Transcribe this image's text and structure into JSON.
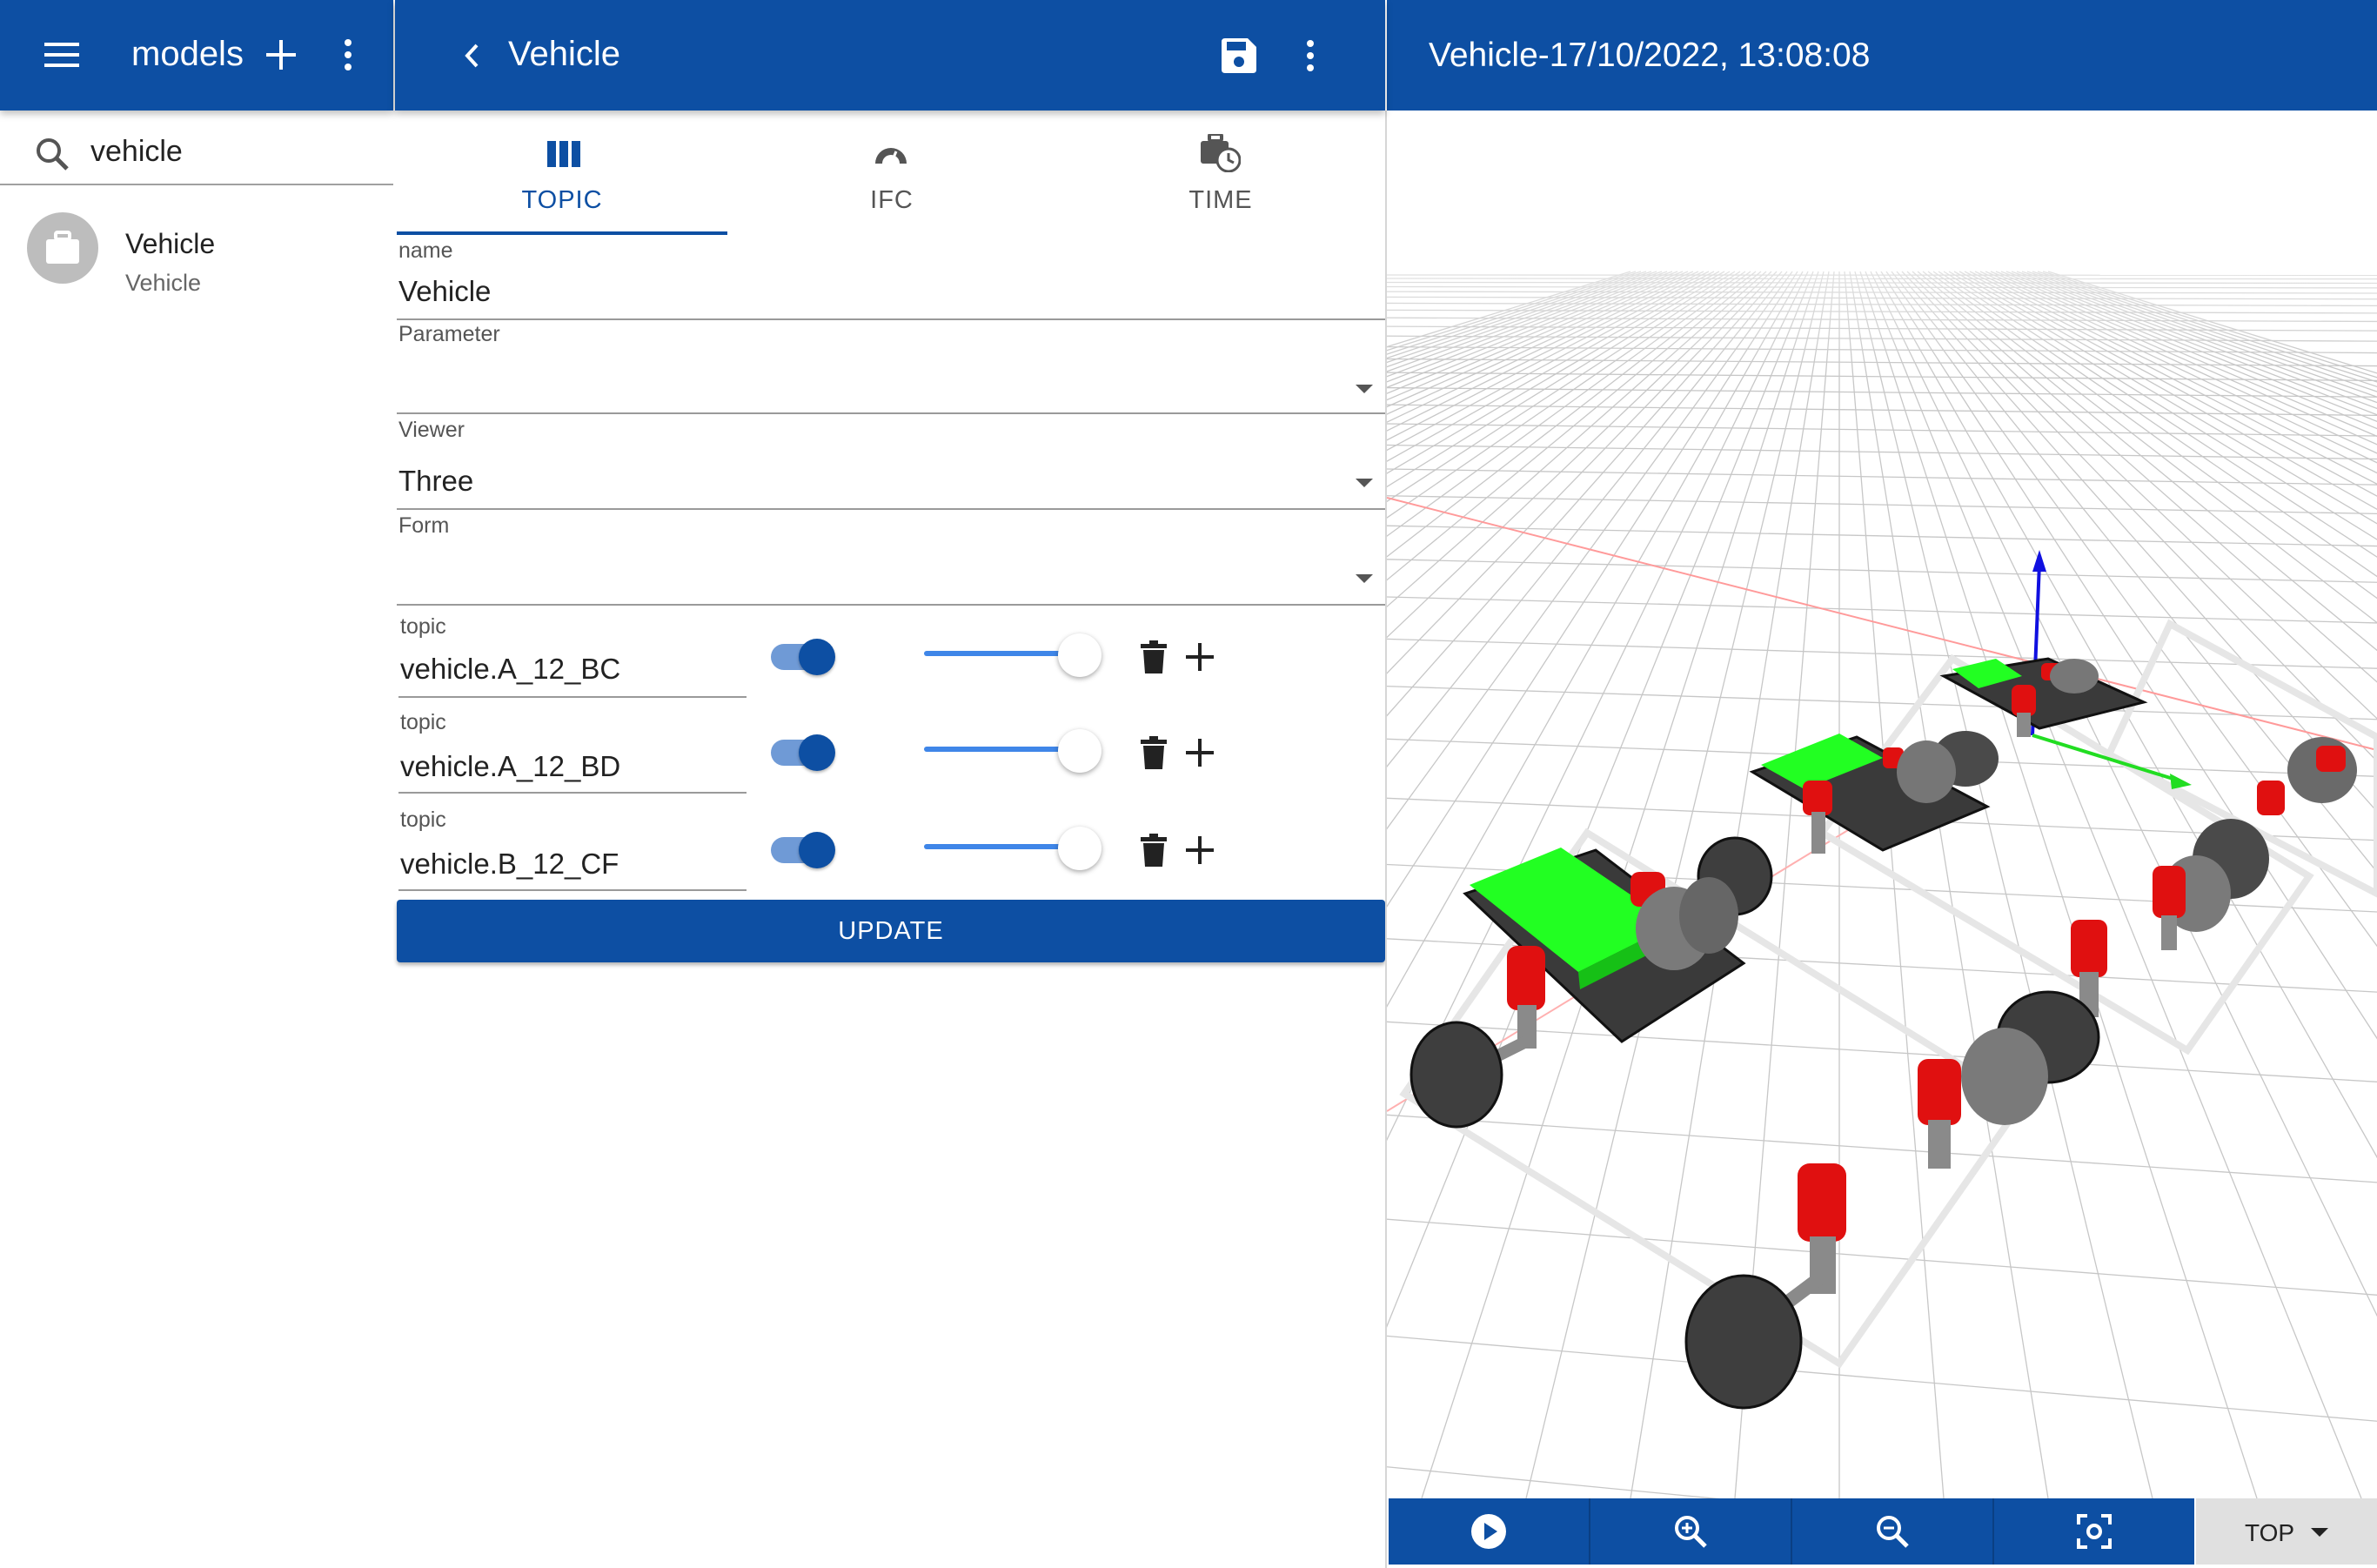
{
  "left_header": {
    "title": "models"
  },
  "search": {
    "value": "vehicle",
    "placeholder": ""
  },
  "model_list": [
    {
      "title": "Vehicle",
      "subtitle": "Vehicle"
    }
  ],
  "editor_header": {
    "title": "Vehicle"
  },
  "tabs": [
    {
      "label": "TOPIC",
      "icon": "columns-icon",
      "active": true
    },
    {
      "label": "IFC",
      "icon": "gauge-icon",
      "active": false
    },
    {
      "label": "TIME",
      "icon": "clock-bag-icon",
      "active": false
    }
  ],
  "form": {
    "name_label": "name",
    "name_value": "Vehicle",
    "parameter_label": "Parameter",
    "parameter_value": "",
    "viewer_label": "Viewer",
    "viewer_value": "Three",
    "form_label": "Form",
    "form_value": ""
  },
  "topics": [
    {
      "label": "topic",
      "value": "vehicle.A_12_BC",
      "enabled": true,
      "level": 1.0
    },
    {
      "label": "topic",
      "value": "vehicle.A_12_BD",
      "enabled": true,
      "level": 1.0
    },
    {
      "label": "topic",
      "value": "vehicle.B_12_CF",
      "enabled": true,
      "level": 1.0
    }
  ],
  "update_button": {
    "label": "UPDATE"
  },
  "viewer_header": {
    "title": "Vehicle-17/10/2022, 13:08:08"
  },
  "viewer_toolbar": {
    "view_select": "TOP"
  },
  "colors": {
    "primary": "#0d4fa3",
    "accent_slider": "#3f86e8",
    "body_green": "#22ff22",
    "part_red": "#e01010"
  }
}
